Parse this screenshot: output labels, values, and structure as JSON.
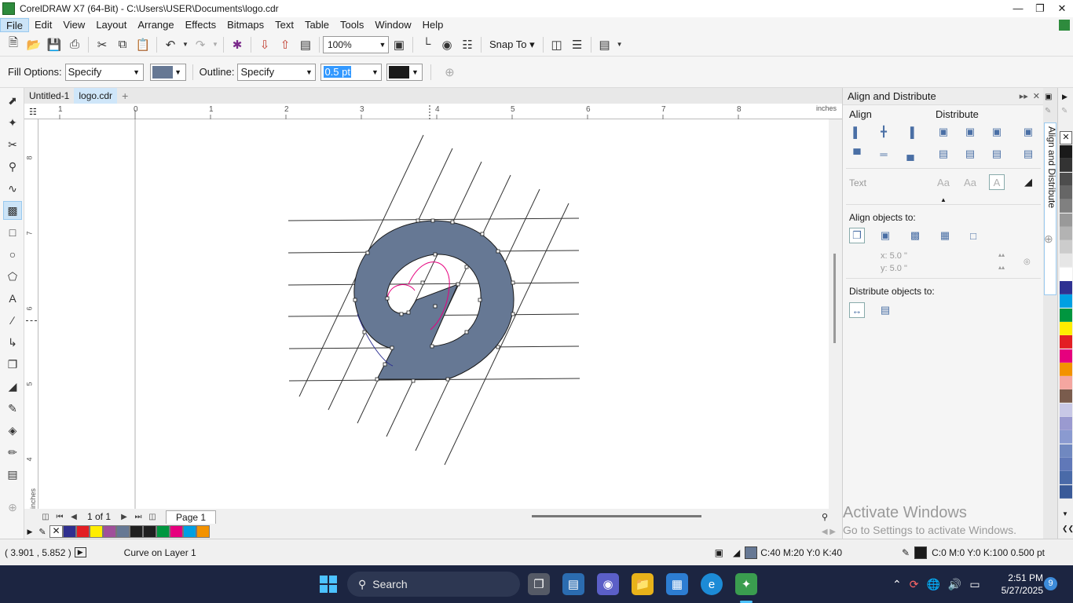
{
  "window": {
    "title": "CorelDRAW X7 (64-Bit) - C:\\Users\\USER\\Documents\\logo.cdr"
  },
  "menu": [
    "File",
    "Edit",
    "View",
    "Layout",
    "Arrange",
    "Effects",
    "Bitmaps",
    "Text",
    "Table",
    "Tools",
    "Window",
    "Help"
  ],
  "standard_toolbar": {
    "zoom": "100%",
    "snap_to": "Snap To"
  },
  "property_bar": {
    "fill_label": "Fill Options:",
    "fill_value": "Specify",
    "fill_color": "#667894",
    "outline_label": "Outline:",
    "outline_value": "Specify",
    "outline_width": "0.5 pt",
    "outline_color": "#1a1a1a"
  },
  "doc_tabs": [
    "Untitled-1",
    "logo.cdr"
  ],
  "rulers": {
    "unit": "inches",
    "h_ticks": [
      "1",
      "0",
      "1",
      "2",
      "3",
      "4",
      "5",
      "6",
      "7",
      "8"
    ],
    "v_ticks": [
      "8",
      "7",
      "6",
      "5",
      "4"
    ]
  },
  "page_nav": {
    "page_count": "1 of 1",
    "page_tab": "Page 1"
  },
  "doc_palette": [
    "#2f2f8f",
    "#e31e24",
    "#ffed00",
    "#a0509a",
    "#667894",
    "#1f1f1f",
    "#1f1f1f",
    "#00963f",
    "#e6007e",
    "#00a0e3",
    "#f39200"
  ],
  "align_panel": {
    "title": "Align and Distribute",
    "align_heading": "Align",
    "distribute_heading": "Distribute",
    "text_label": "Text",
    "align_objects_to": "Align objects to:",
    "x_value": "x:  5.0 \"",
    "y_value": "y:  5.0 \"",
    "distribute_objects_to": "Distribute objects to:"
  },
  "docker_tab": "Align and Distribute",
  "color_palette": [
    "#1a1a1a",
    "#333333",
    "#4d4d4d",
    "#666666",
    "#808080",
    "#999999",
    "#b3b3b3",
    "#cccccc",
    "#e6e6e6",
    "#ffffff",
    "#2e3192",
    "#00a0e3",
    "#00963f",
    "#ffed00",
    "#e31e24",
    "#e6007e",
    "#f39200",
    "#f4a6a0",
    "#7a5c4d",
    "#c8c8e6",
    "#9a9ad0",
    "#8a9ad0",
    "#7088c0",
    "#6078b8",
    "#4a6aa8",
    "#3a5a98"
  ],
  "statusbar": {
    "coords": "( 3.901 , 5.852  )",
    "object_info": "Curve on Layer 1",
    "fill_color": "#667894",
    "fill_info": "C:40 M:20 Y:0 K:40",
    "outline_color": "#1a1a1a",
    "outline_info": "C:0 M:0 Y:0 K:100  0.500 pt"
  },
  "watermark": {
    "line1": "Activate Windows",
    "line2": "Go to Settings to activate Windows."
  },
  "taskbar": {
    "search": "Search",
    "time": "2:51 PM",
    "date": "5/27/2025",
    "badge": "9"
  }
}
